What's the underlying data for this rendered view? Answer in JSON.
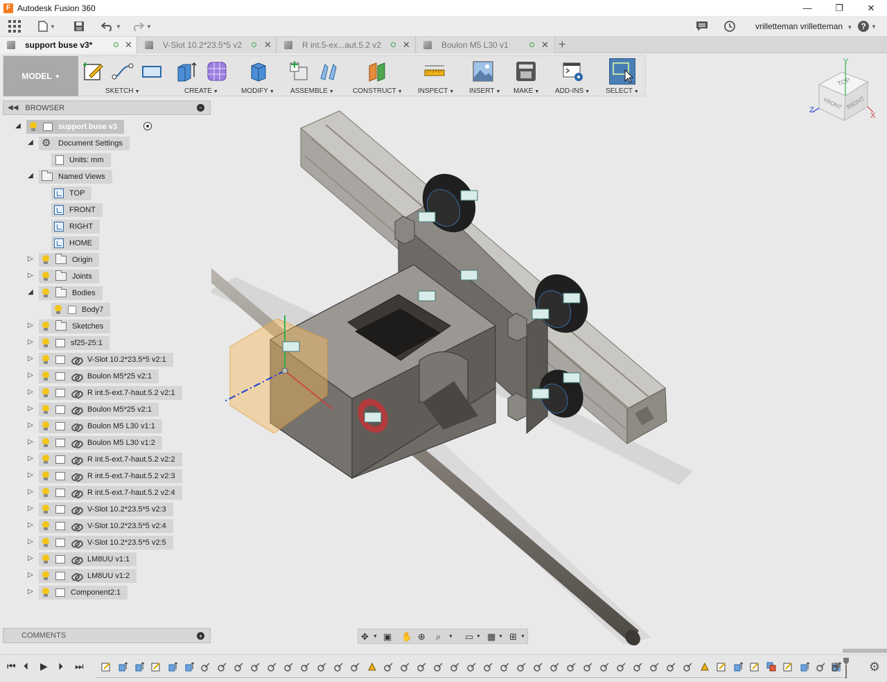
{
  "app": {
    "title": "Autodesk Fusion 360",
    "logo_letter": "F"
  },
  "window_controls": {
    "minimize": "—",
    "restore": "❐",
    "close": "✕"
  },
  "quickbar": {
    "user": "vrilletteman vrilletteman",
    "help": "?"
  },
  "tabs": [
    {
      "label": "support buse v3*",
      "active": true
    },
    {
      "label": "V-Slot 10.2*23.5*5 v2",
      "active": false
    },
    {
      "label": "R int.5-ex...aut.5.2 v2",
      "active": false
    },
    {
      "label": "Boulon M5 L30 v1",
      "active": false
    }
  ],
  "toolbar": {
    "model": "MODEL",
    "groups": [
      "SKETCH",
      "CREATE",
      "MODIFY",
      "ASSEMBLE",
      "CONSTRUCT",
      "INSPECT",
      "INSERT",
      "MAKE",
      "ADD-INS",
      "SELECT"
    ]
  },
  "browser": {
    "title": "BROWSER",
    "root": "support buse v3",
    "document_settings": "Document Settings",
    "units": "Units: mm",
    "named_views": "Named Views",
    "views": [
      "TOP",
      "FRONT",
      "RIGHT",
      "HOME"
    ],
    "origin": "Origin",
    "joints": "Joints",
    "bodies": "Bodies",
    "body7": "Body7",
    "sketches": "Sketches",
    "components": [
      "sf25-25:1",
      "V-Slot 10.2*23.5*5 v2:1",
      "Boulon M5*25 v2:1",
      "R int.5-ext.7-haut.5.2 v2:1",
      "Boulon M5*25 v2:1",
      "Boulon M5 L30 v1:1",
      "Boulon M5 L30 v1:2",
      "R int.5-ext.7-haut.5.2 v2:2",
      "R int.5-ext.7-haut.5.2 v2:3",
      "R int.5-ext.7-haut.5.2 v2:4",
      "V-Slot 10.2*23.5*5 v2:3",
      "V-Slot 10.2*23.5*5 v2:4",
      "V-Slot 10.2*23.5*5 v2:5",
      "LM8UU v1:1",
      "LM8UU v1:2",
      "Component2:1"
    ]
  },
  "comments": {
    "label": "COMMENTS"
  },
  "viewcube": {
    "top": "TOP",
    "front": "FRONT",
    "right": "RIGHT",
    "axis_x": "X",
    "axis_y": "Y",
    "axis_z": "Z"
  },
  "colors": {
    "accent_blue": "#3a6ea5",
    "bulb": "#f2c518",
    "select_active": "#4a7fb5",
    "model_button": "#a9a9a9"
  }
}
